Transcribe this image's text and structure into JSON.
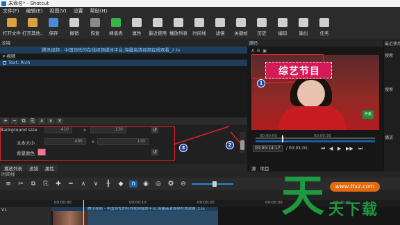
{
  "window": {
    "title": "未命名* - Shotcut"
  },
  "menu": [
    "文件(F)",
    "编辑(E)",
    "视图(V)",
    "设置",
    "帮助(H)"
  ],
  "toolbar": [
    {
      "label": "打开文件",
      "icon": "folder-open-icon",
      "color": "#d9a23a"
    },
    {
      "label": "打开其他..",
      "icon": "folder-other-icon",
      "color": "#d9a23a"
    },
    {
      "label": "保存",
      "icon": "save-icon",
      "color": "#4a8ad6"
    },
    {
      "label": "撤销",
      "icon": "undo-icon",
      "color": "#cfcfcf"
    },
    {
      "label": "恢复",
      "icon": "redo-icon",
      "color": "#8a8a8a"
    },
    {
      "label": "峰值表",
      "icon": "peak-meter-icon",
      "color": "#3bb34a"
    },
    {
      "label": "属性",
      "icon": "properties-icon",
      "color": "#cfcfcf"
    },
    {
      "label": "最近使用",
      "icon": "recent-icon",
      "color": "#cfcfcf"
    },
    {
      "label": "播放列表",
      "icon": "playlist-icon",
      "color": "#cfcfcf"
    },
    {
      "label": "时间线",
      "icon": "timeline-icon",
      "color": "#cfcfcf"
    },
    {
      "label": "滤镜",
      "icon": "filter-icon",
      "color": "#cfcfcf"
    },
    {
      "label": "关键帧",
      "icon": "keyframes-icon",
      "color": "#cfcfcf"
    },
    {
      "label": "历史",
      "icon": "history-icon",
      "color": "#cfcfcf"
    },
    {
      "label": "编码",
      "icon": "encode-icon",
      "color": "#cfcfcf"
    },
    {
      "label": "输出",
      "icon": "export-icon",
      "color": "#cfcfcf"
    },
    {
      "label": "任务",
      "icon": "jobs-icon",
      "color": "#cfcfcf"
    }
  ],
  "filters": {
    "header": "滤镜",
    "clip_name": "腾讯视频 - 中国领先的在线视频媒体平台,海量高清视频在线观看_2.ts",
    "list": [
      {
        "label": "视频",
        "selected": false
      },
      {
        "label": "Text: Rich",
        "selected": true
      }
    ],
    "tool_buttons": [
      "+",
      "−",
      "⧉",
      "⎘",
      "∧",
      "∨",
      "✕"
    ],
    "params": {
      "bg_size_label": "Background size",
      "bg_size_w": "410",
      "bg_size_h": "130",
      "bg_size_sep": "x",
      "text_size_label": "文本大小",
      "text_size_w": "486",
      "text_size_h": "130",
      "text_size_sep": "x",
      "bg_color_label": "背景颜色",
      "bg_color": "#ff6f91"
    }
  },
  "left_tabs": [
    "播放列表",
    "滤镜",
    "属性"
  ],
  "player": {
    "header": "源码",
    "tabs": [
      "A",
      "B",
      "▣"
    ],
    "video_title_text": "综艺节目",
    "logo_text": "芒果",
    "timecode_current": "00:00:14:17",
    "timecode_total": "/ 00:01:01:",
    "ticks": [
      "00:00:00",
      "00:00:30"
    ],
    "source_tabs": [
      "源",
      "项目"
    ]
  },
  "right_panel": {
    "items": [
      "最近使用",
      "搜索",
      "搜索",
      "播放"
    ]
  },
  "timeline": {
    "header": "时间线",
    "ruler": [
      "00:00:00",
      "00:00:10",
      "00:00:20",
      "00:00:30",
      "00:00:40"
    ],
    "track_label": "V1",
    "clip_title": "腾讯视频 - 中国领先的在线视频媒体平台,海量高清视频在线观看_2.ts"
  },
  "annotations": [
    "1",
    "2",
    "3"
  ],
  "watermark": {
    "big": "天",
    "small": "天下载",
    "url": "www.ttxz.com"
  }
}
